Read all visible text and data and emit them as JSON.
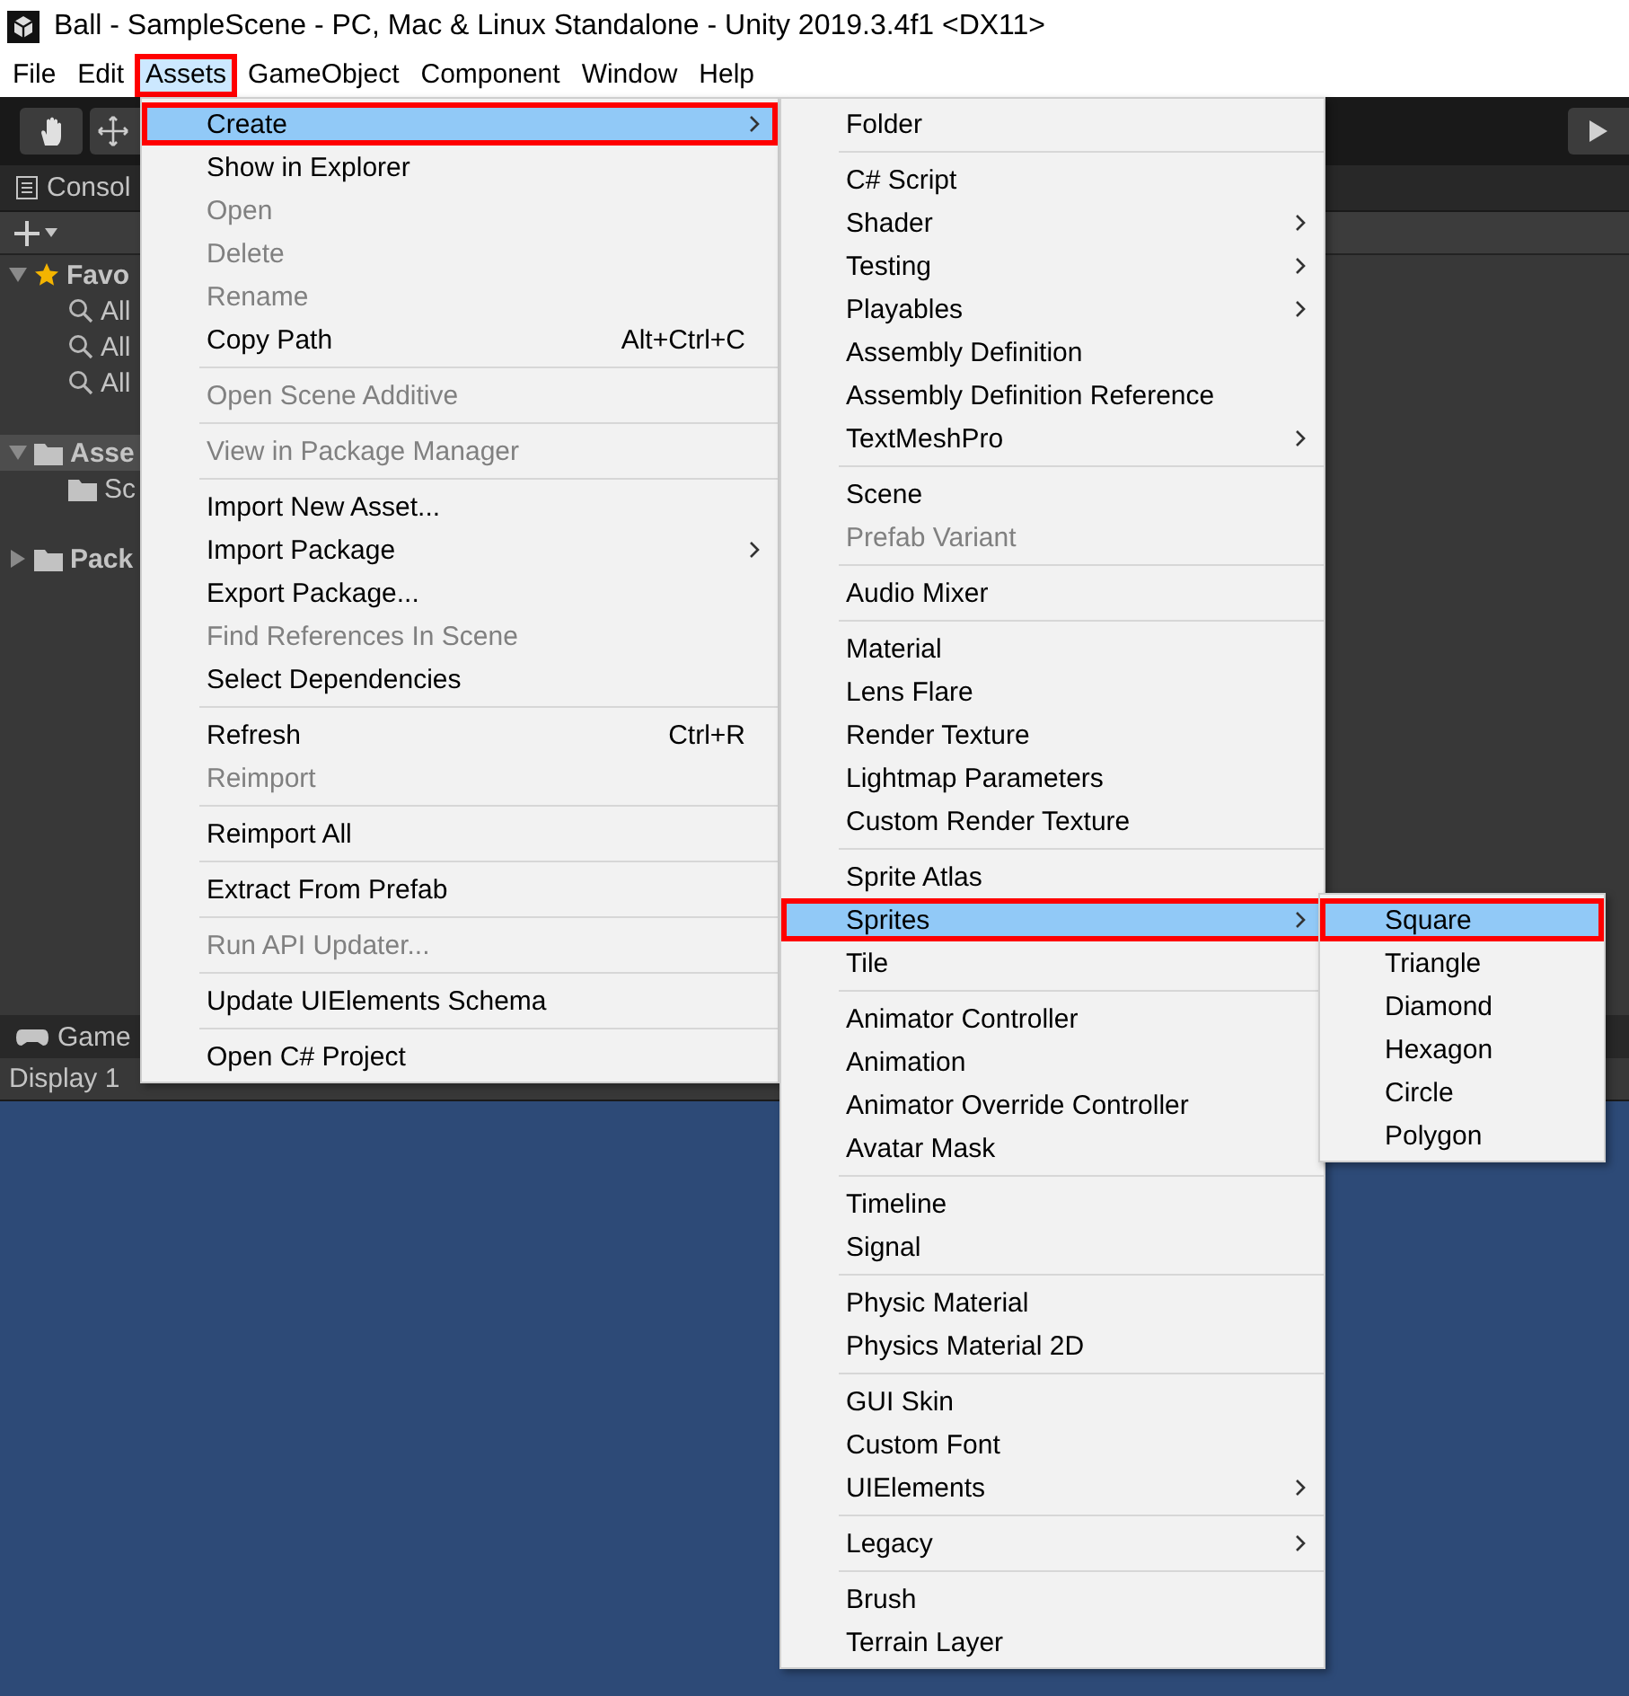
{
  "window": {
    "title": "Ball - SampleScene - PC, Mac & Linux Standalone - Unity 2019.3.4f1 <DX11>"
  },
  "menubar": [
    {
      "label": "File",
      "selected": false
    },
    {
      "label": "Edit",
      "selected": false
    },
    {
      "label": "Assets",
      "selected": true
    },
    {
      "label": "GameObject",
      "selected": false
    },
    {
      "label": "Component",
      "selected": false
    },
    {
      "label": "Window",
      "selected": false
    },
    {
      "label": "Help",
      "selected": false
    }
  ],
  "project_panel": {
    "tab": "Consol",
    "tree": [
      {
        "kind": "favorites",
        "label": "Favo",
        "expanded": true,
        "selected": false,
        "children": [
          {
            "kind": "search",
            "label": "All",
            "selected": false
          },
          {
            "kind": "search",
            "label": "All",
            "selected": false
          },
          {
            "kind": "search",
            "label": "All",
            "selected": false
          }
        ]
      },
      {
        "kind": "folder",
        "label": "Asse",
        "expanded": true,
        "selected": true,
        "children": [
          {
            "kind": "folder",
            "label": "Sc",
            "selected": false
          }
        ]
      },
      {
        "kind": "folder",
        "label": "Pack",
        "expanded": false,
        "selected": false
      }
    ]
  },
  "game_panel": {
    "tab": "Game",
    "display": "Display 1"
  },
  "assets_menu": {
    "items": [
      {
        "kind": "item",
        "label": "Create",
        "disabled": false,
        "selected": true,
        "submenu": true
      },
      {
        "kind": "item",
        "label": "Show in Explorer",
        "disabled": false,
        "selected": false,
        "submenu": false
      },
      {
        "kind": "item",
        "label": "Open",
        "disabled": true,
        "selected": false,
        "submenu": false
      },
      {
        "kind": "item",
        "label": "Delete",
        "disabled": true,
        "selected": false,
        "submenu": false
      },
      {
        "kind": "item",
        "label": "Rename",
        "disabled": true,
        "selected": false,
        "submenu": false
      },
      {
        "kind": "item",
        "label": "Copy Path",
        "shortcut": "Alt+Ctrl+C",
        "disabled": false,
        "selected": false,
        "submenu": false
      },
      {
        "kind": "separator"
      },
      {
        "kind": "item",
        "label": "Open Scene Additive",
        "disabled": true,
        "selected": false,
        "submenu": false
      },
      {
        "kind": "separator"
      },
      {
        "kind": "item",
        "label": "View in Package Manager",
        "disabled": true,
        "selected": false,
        "submenu": false
      },
      {
        "kind": "separator"
      },
      {
        "kind": "item",
        "label": "Import New Asset...",
        "disabled": false,
        "selected": false,
        "submenu": false
      },
      {
        "kind": "item",
        "label": "Import Package",
        "disabled": false,
        "selected": false,
        "submenu": true
      },
      {
        "kind": "item",
        "label": "Export Package...",
        "disabled": false,
        "selected": false,
        "submenu": false
      },
      {
        "kind": "item",
        "label": "Find References In Scene",
        "disabled": true,
        "selected": false,
        "submenu": false
      },
      {
        "kind": "item",
        "label": "Select Dependencies",
        "disabled": false,
        "selected": false,
        "submenu": false
      },
      {
        "kind": "separator"
      },
      {
        "kind": "item",
        "label": "Refresh",
        "shortcut": "Ctrl+R",
        "disabled": false,
        "selected": false,
        "submenu": false
      },
      {
        "kind": "item",
        "label": "Reimport",
        "disabled": true,
        "selected": false,
        "submenu": false
      },
      {
        "kind": "separator"
      },
      {
        "kind": "item",
        "label": "Reimport All",
        "disabled": false,
        "selected": false,
        "submenu": false
      },
      {
        "kind": "separator"
      },
      {
        "kind": "item",
        "label": "Extract From Prefab",
        "disabled": false,
        "selected": false,
        "submenu": false
      },
      {
        "kind": "separator"
      },
      {
        "kind": "item",
        "label": "Run API Updater...",
        "disabled": true,
        "selected": false,
        "submenu": false
      },
      {
        "kind": "separator"
      },
      {
        "kind": "item",
        "label": "Update UIElements Schema",
        "disabled": false,
        "selected": false,
        "submenu": false
      },
      {
        "kind": "separator"
      },
      {
        "kind": "item",
        "label": "Open C# Project",
        "disabled": false,
        "selected": false,
        "submenu": false
      }
    ]
  },
  "create_menu": {
    "items": [
      {
        "kind": "item",
        "label": "Folder",
        "disabled": false,
        "selected": false,
        "submenu": false
      },
      {
        "kind": "separator"
      },
      {
        "kind": "item",
        "label": "C# Script",
        "disabled": false,
        "selected": false,
        "submenu": false
      },
      {
        "kind": "item",
        "label": "Shader",
        "disabled": false,
        "selected": false,
        "submenu": true
      },
      {
        "kind": "item",
        "label": "Testing",
        "disabled": false,
        "selected": false,
        "submenu": true
      },
      {
        "kind": "item",
        "label": "Playables",
        "disabled": false,
        "selected": false,
        "submenu": true
      },
      {
        "kind": "item",
        "label": "Assembly Definition",
        "disabled": false,
        "selected": false,
        "submenu": false
      },
      {
        "kind": "item",
        "label": "Assembly Definition Reference",
        "disabled": false,
        "selected": false,
        "submenu": false
      },
      {
        "kind": "item",
        "label": "TextMeshPro",
        "disabled": false,
        "selected": false,
        "submenu": true
      },
      {
        "kind": "separator"
      },
      {
        "kind": "item",
        "label": "Scene",
        "disabled": false,
        "selected": false,
        "submenu": false
      },
      {
        "kind": "item",
        "label": "Prefab Variant",
        "disabled": true,
        "selected": false,
        "submenu": false
      },
      {
        "kind": "separator"
      },
      {
        "kind": "item",
        "label": "Audio Mixer",
        "disabled": false,
        "selected": false,
        "submenu": false
      },
      {
        "kind": "separator"
      },
      {
        "kind": "item",
        "label": "Material",
        "disabled": false,
        "selected": false,
        "submenu": false
      },
      {
        "kind": "item",
        "label": "Lens Flare",
        "disabled": false,
        "selected": false,
        "submenu": false
      },
      {
        "kind": "item",
        "label": "Render Texture",
        "disabled": false,
        "selected": false,
        "submenu": false
      },
      {
        "kind": "item",
        "label": "Lightmap Parameters",
        "disabled": false,
        "selected": false,
        "submenu": false
      },
      {
        "kind": "item",
        "label": "Custom Render Texture",
        "disabled": false,
        "selected": false,
        "submenu": false
      },
      {
        "kind": "separator"
      },
      {
        "kind": "item",
        "label": "Sprite Atlas",
        "disabled": false,
        "selected": false,
        "submenu": false
      },
      {
        "kind": "item",
        "label": "Sprites",
        "disabled": false,
        "selected": true,
        "submenu": true
      },
      {
        "kind": "item",
        "label": "Tile",
        "disabled": false,
        "selected": false,
        "submenu": false
      },
      {
        "kind": "separator"
      },
      {
        "kind": "item",
        "label": "Animator Controller",
        "disabled": false,
        "selected": false,
        "submenu": false
      },
      {
        "kind": "item",
        "label": "Animation",
        "disabled": false,
        "selected": false,
        "submenu": false
      },
      {
        "kind": "item",
        "label": "Animator Override Controller",
        "disabled": false,
        "selected": false,
        "submenu": false
      },
      {
        "kind": "item",
        "label": "Avatar Mask",
        "disabled": false,
        "selected": false,
        "submenu": false
      },
      {
        "kind": "separator"
      },
      {
        "kind": "item",
        "label": "Timeline",
        "disabled": false,
        "selected": false,
        "submenu": false
      },
      {
        "kind": "item",
        "label": "Signal",
        "disabled": false,
        "selected": false,
        "submenu": false
      },
      {
        "kind": "separator"
      },
      {
        "kind": "item",
        "label": "Physic Material",
        "disabled": false,
        "selected": false,
        "submenu": false
      },
      {
        "kind": "item",
        "label": "Physics Material 2D",
        "disabled": false,
        "selected": false,
        "submenu": false
      },
      {
        "kind": "separator"
      },
      {
        "kind": "item",
        "label": "GUI Skin",
        "disabled": false,
        "selected": false,
        "submenu": false
      },
      {
        "kind": "item",
        "label": "Custom Font",
        "disabled": false,
        "selected": false,
        "submenu": false
      },
      {
        "kind": "item",
        "label": "UIElements",
        "disabled": false,
        "selected": false,
        "submenu": true
      },
      {
        "kind": "separator"
      },
      {
        "kind": "item",
        "label": "Legacy",
        "disabled": false,
        "selected": false,
        "submenu": true
      },
      {
        "kind": "separator"
      },
      {
        "kind": "item",
        "label": "Brush",
        "disabled": false,
        "selected": false,
        "submenu": false
      },
      {
        "kind": "item",
        "label": "Terrain Layer",
        "disabled": false,
        "selected": false,
        "submenu": false
      }
    ]
  },
  "sprites_menu": {
    "items": [
      {
        "kind": "item",
        "label": "Square",
        "disabled": false,
        "selected": true,
        "submenu": false
      },
      {
        "kind": "item",
        "label": "Triangle",
        "disabled": false,
        "selected": false,
        "submenu": false
      },
      {
        "kind": "item",
        "label": "Diamond",
        "disabled": false,
        "selected": false,
        "submenu": false
      },
      {
        "kind": "item",
        "label": "Hexagon",
        "disabled": false,
        "selected": false,
        "submenu": false
      },
      {
        "kind": "item",
        "label": "Circle",
        "disabled": false,
        "selected": false,
        "submenu": false
      },
      {
        "kind": "item",
        "label": "Polygon",
        "disabled": false,
        "selected": false,
        "submenu": false
      }
    ]
  }
}
